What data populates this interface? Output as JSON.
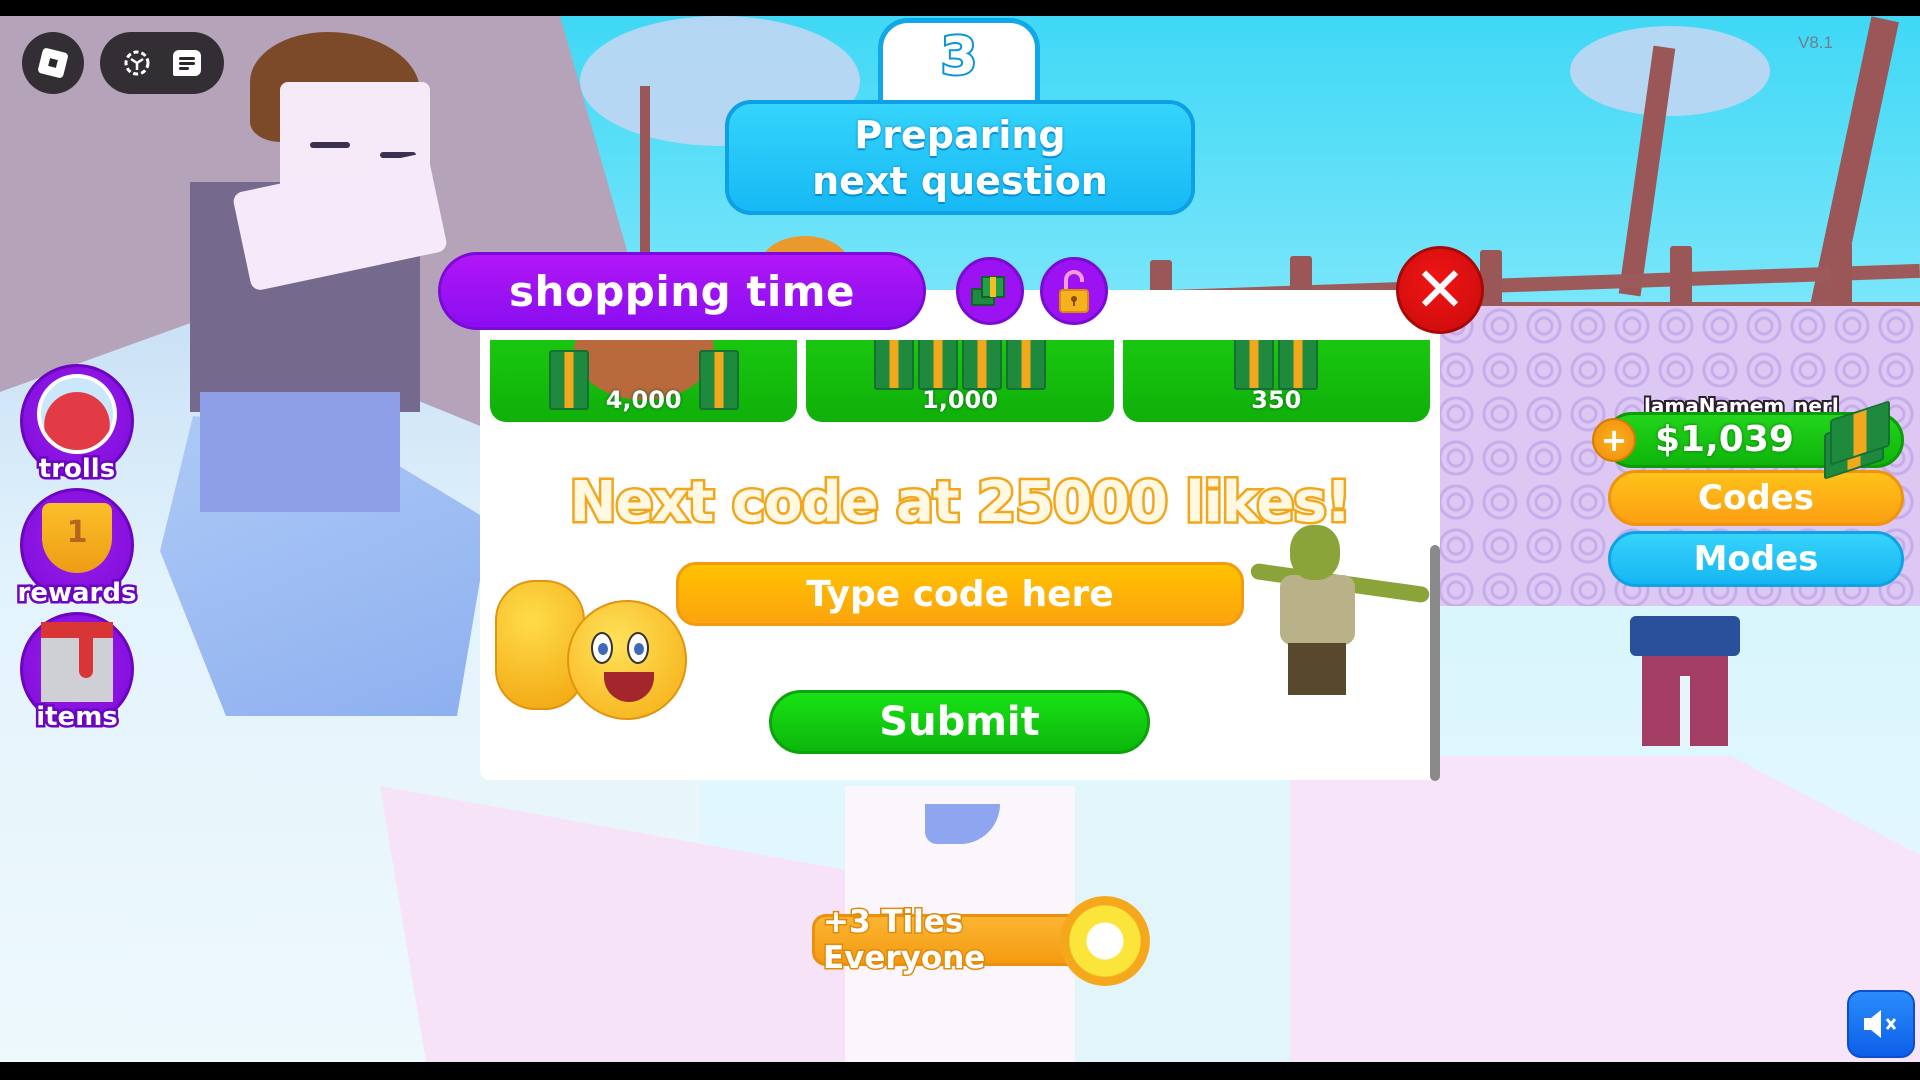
{
  "roblox_ui": {
    "menu_icon": "roblox-logo-icon",
    "pill_icons": [
      "selfie-view-icon",
      "chat-icon"
    ],
    "version": "V8.1"
  },
  "round": {
    "countdown": "3",
    "status": "Preparing next question"
  },
  "shop": {
    "title": "shopping time",
    "header_buttons": [
      {
        "name": "cash-tab",
        "icon": "cash-stack-icon"
      },
      {
        "name": "unlock-tab",
        "icon": "padlock-open-icon"
      }
    ],
    "close_icon": "close-x-icon",
    "items": [
      {
        "amount": "4,000",
        "icon": "money-bag-icon"
      },
      {
        "amount": "1,000",
        "icon": "cash-pile-icon"
      },
      {
        "amount": "350",
        "icon": "cash-stack-icon"
      }
    ],
    "codes": {
      "headline": "Next code at 25000 likes!",
      "input_value": "",
      "input_placeholder": "Type code here",
      "submit_label": "Submit"
    },
    "decorations": [
      "thumbs-up-emoji",
      "shrek-t-pose"
    ]
  },
  "sidebar": {
    "items": [
      {
        "label": "trolls",
        "icon": "potion-icon"
      },
      {
        "label": "rewards",
        "icon": "trophy-icon"
      },
      {
        "label": "items",
        "icon": "paint-bucket-icon"
      }
    ]
  },
  "hud": {
    "username": "lamaNamem_nerl",
    "money": "$1,039",
    "add_money_label": "+",
    "codes_label": "Codes",
    "modes_label": "Modes"
  },
  "powerup": {
    "label": "+3 Tiles Everyone",
    "icon": "sun-burst-icon"
  },
  "audio": {
    "mute_icon": "speaker-muted-icon"
  },
  "colors": {
    "shop_purple": "#9c12f2",
    "banner_blue": "#17b9f5",
    "code_orange": "#fda40f",
    "submit_green": "#0cb70b",
    "close_red": "#e01010"
  }
}
